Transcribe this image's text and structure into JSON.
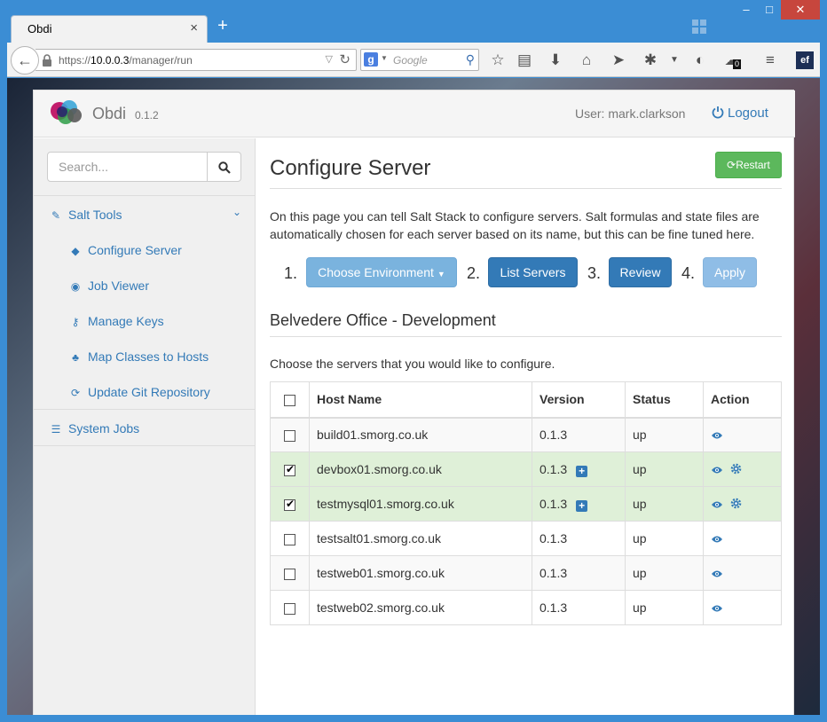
{
  "browser": {
    "tab_title": "Obdi",
    "tab_close": "×",
    "new_tab": "+",
    "url_prefix": "https://",
    "url_host": "10.0.0.3",
    "url_path": "/manager/run",
    "search_engine": "g",
    "search_placeholder": "Google",
    "toolbar_badge": "0",
    "ext_label": "ef",
    "window_controls": [
      "–",
      "□",
      "✕"
    ]
  },
  "app": {
    "brand": "Obdi",
    "version": "0.1.2",
    "user_label": "User: mark.clarkson",
    "logout_label": "Logout"
  },
  "sidebar": {
    "search_placeholder": "Search...",
    "group": {
      "label": "Salt Tools",
      "icon": "edit-icon"
    },
    "items": [
      {
        "label": "Configure Server",
        "icon": "tags-icon"
      },
      {
        "label": "Job Viewer",
        "icon": "eye-icon"
      },
      {
        "label": "Manage Keys",
        "icon": "key-icon"
      },
      {
        "label": "Map Classes to Hosts",
        "icon": "sitemap-icon"
      },
      {
        "label": "Update Git Repository",
        "icon": "refresh-icon"
      }
    ],
    "system_jobs": {
      "label": "System Jobs",
      "icon": "tasks-icon"
    }
  },
  "main": {
    "title": "Configure Server",
    "restart_label": "Restart",
    "intro": "On this page you can tell Salt Stack to configure servers. Salt formulas and state files are automatically chosen for each server based on its name, but this can be fine tuned here.",
    "steps": [
      {
        "num": "1.",
        "label": "Choose Environment",
        "color": "#7ab3de"
      },
      {
        "num": "2.",
        "label": "List Servers",
        "color": "#337ab7"
      },
      {
        "num": "3.",
        "label": "Review",
        "color": "#337ab7"
      },
      {
        "num": "4.",
        "label": "Apply",
        "color": "#8fbde6"
      }
    ],
    "section_title": "Belvedere Office - Development",
    "choose_text": "Choose the servers that you would like to configure.",
    "table": {
      "columns": [
        "Host Name",
        "Version",
        "Status",
        "Action"
      ],
      "rows": [
        {
          "host": "build01.smorg.co.uk",
          "version": "0.1.3",
          "status": "up",
          "checked": false
        },
        {
          "host": "devbox01.smorg.co.uk",
          "version": "0.1.3",
          "status": "up",
          "checked": true
        },
        {
          "host": "testmysql01.smorg.co.uk",
          "version": "0.1.3",
          "status": "up",
          "checked": true
        },
        {
          "host": "testsalt01.smorg.co.uk",
          "version": "0.1.3",
          "status": "up",
          "checked": false
        },
        {
          "host": "testweb01.smorg.co.uk",
          "version": "0.1.3",
          "status": "up",
          "checked": false
        },
        {
          "host": "testweb02.smorg.co.uk",
          "version": "0.1.3",
          "status": "up",
          "checked": false
        }
      ]
    }
  },
  "colors": {
    "link": "#337ab7",
    "success": "#5cb85c",
    "selected_row": "#dff0d8"
  }
}
